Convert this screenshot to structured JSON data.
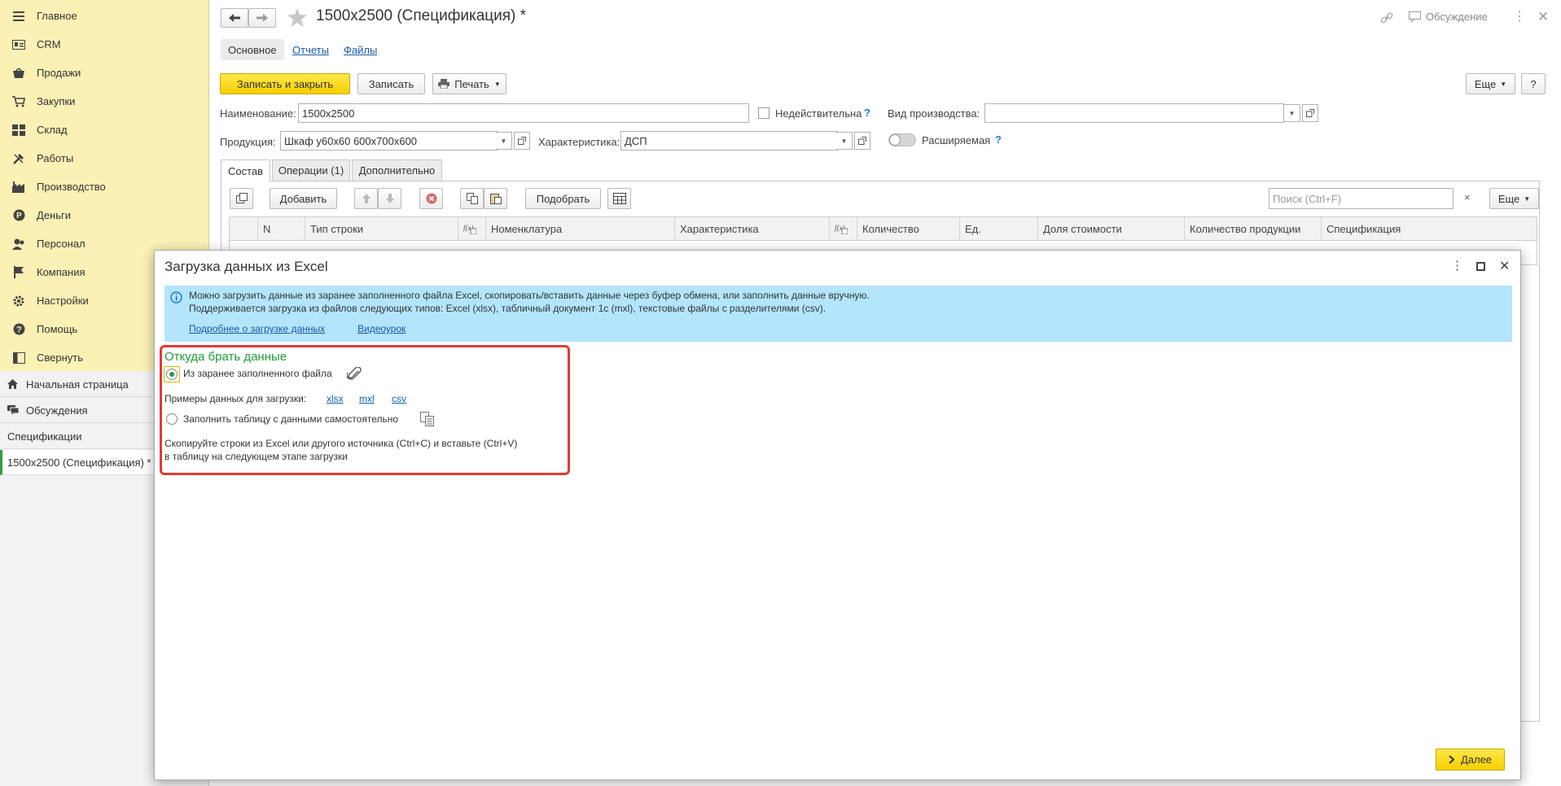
{
  "sidebar": {
    "items": [
      {
        "label": "Главное",
        "icon": "menu-icon"
      },
      {
        "label": "CRM",
        "icon": "crm-icon"
      },
      {
        "label": "Продажи",
        "icon": "sales-icon"
      },
      {
        "label": "Закупки",
        "icon": "purchases-icon"
      },
      {
        "label": "Склад",
        "icon": "warehouse-icon"
      },
      {
        "label": "Работы",
        "icon": "works-icon"
      },
      {
        "label": "Производство",
        "icon": "production-icon"
      },
      {
        "label": "Деньги",
        "icon": "money-icon"
      },
      {
        "label": "Персонал",
        "icon": "staff-icon"
      },
      {
        "label": "Компания",
        "icon": "company-icon"
      },
      {
        "label": "Настройки",
        "icon": "gear-icon"
      },
      {
        "label": "Помощь",
        "icon": "help-icon"
      },
      {
        "label": "Свернуть",
        "icon": "collapse-icon"
      }
    ],
    "bottom": {
      "home": "Начальная страница",
      "discussions": "Обсуждения",
      "section": "Спецификации",
      "open_doc": "1500x2500 (Спецификация) *"
    }
  },
  "header": {
    "title": "1500x2500 (Спецификация) *",
    "discussion": "Обсуждение"
  },
  "doc_tabs": {
    "main": "Основное",
    "reports": "Отчеты",
    "files": "Файлы"
  },
  "toolbar": {
    "save_close": "Записать и закрыть",
    "save": "Записать",
    "print": "Печать",
    "more": "Еще",
    "help": "?"
  },
  "form": {
    "name_label": "Наименование:",
    "name_value": "1500x2500",
    "invalid_label": "Недействительна",
    "prod_kind_label": "Вид производства:",
    "prod_kind_value": "",
    "product_label": "Продукция:",
    "product_value": "Шкаф у60х60 600х700х600",
    "char_label": "Характеристика:",
    "char_value": "ДСП",
    "extendable_label": "Расширяемая",
    "hint": "?"
  },
  "section_tabs": {
    "composition": "Состав",
    "operations": "Операции (1)",
    "additional": "Дополнительно"
  },
  "table_toolbar": {
    "add": "Добавить",
    "pick": "Подобрать",
    "search_placeholder": "Поиск (Ctrl+F)",
    "more": "Еще"
  },
  "table": {
    "columns": [
      "N",
      "Тип строки",
      "Номенклатура",
      "Характеристика",
      "Количество",
      "Ед.",
      "Доля стоимости",
      "Количество продукции",
      "Спецификация"
    ]
  },
  "dialog": {
    "title": "Загрузка данных из Excel",
    "info_line1": "Можно загрузить данные из заранее заполненного файла Excel, скопировать/вставить данные через буфер обмена, или заполнить данные вручную.",
    "info_line2": "Поддерживается загрузка из файлов следующих типов: Excel (xlsx), табличный документ 1с (mxl), текстовые файлы с разделителями (csv).",
    "link_more": "Подробнее о загрузке данных",
    "link_video": "Видеоурок",
    "source_heading": "Откуда брать данные",
    "option_file": "Из заранее заполненного файла",
    "examples_label": "Примеры данных для загрузки:",
    "examples": [
      "xlsx",
      "mxl",
      "csv"
    ],
    "option_manual": "Заполнить таблицу с данными самостоятельно",
    "copy_hint_line1": "Скопируйте строки из Excel или другого источника (Ctrl+C) и вставьте (Ctrl+V)",
    "copy_hint_line2": "в таблицу на следующем этапе загрузки",
    "next": "Далее",
    "selected_option": "file"
  },
  "colors": {
    "sidebar_bg": "#fbf1b5",
    "accent_yellow": "#f5d000",
    "info_bg": "#b3e5fc",
    "green_heading": "#1e9e3a",
    "highlight_red": "#e53935",
    "link_blue": "#1a5aa8"
  }
}
